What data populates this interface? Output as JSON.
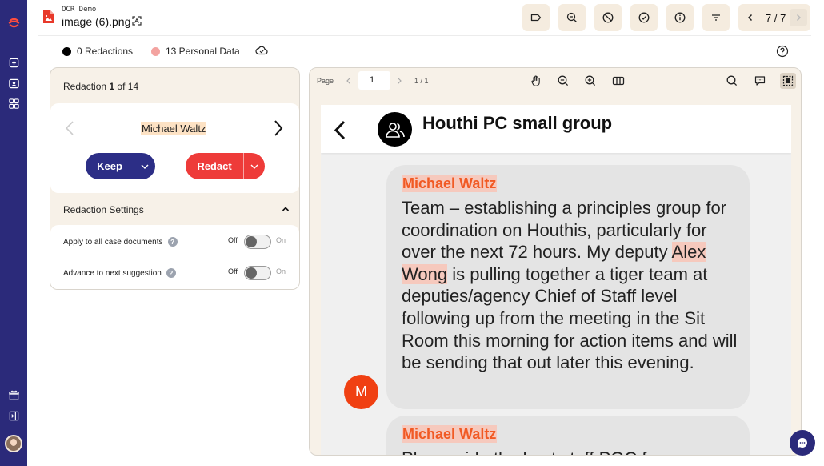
{
  "app": {
    "demo_label": "OCR Demo",
    "file_name": "image (6).png",
    "brand_color": "#2b2a7a",
    "accent_color": "#ee3b39"
  },
  "toolbar": {
    "icons": [
      "label-icon",
      "zoom-search-icon",
      "block-icon",
      "check-circle-icon",
      "info-icon",
      "filter-icon"
    ],
    "pager": {
      "count": "7 / 7"
    }
  },
  "stats": {
    "redactions": "0 Redactions",
    "personal_data": "13 Personal Data",
    "redaction_color": "#000000",
    "personal_data_color": "#f3a3a0"
  },
  "panel": {
    "title_prefix": "Redaction",
    "current": "1",
    "title_middle": " of ",
    "total": "14",
    "entity": "Michael Waltz",
    "keep_label": "Keep",
    "redact_label": "Redact",
    "settings_title": "Redaction Settings",
    "settings": [
      {
        "label": "Apply to all case documents",
        "off": "Off",
        "on": "On"
      },
      {
        "label": "Advance to next suggestion",
        "off": "Off",
        "on": "On"
      }
    ]
  },
  "viewer": {
    "page_label": "Page",
    "page_value": "1",
    "page_count": "1 / 1",
    "document": {
      "group_name": "Houthi PC small group",
      "messages": [
        {
          "sender": "Michael Waltz",
          "text_before": "Team – establishing a principles group for coordination on Houthis, particularly for over the next 72 hours. My deputy ",
          "highlight": "Alex Wong",
          "text_after": " is pulling together a tiger team at deputies/agency Chief of Staff level following up from the meeting in the Sit Room this morning for action items and will be sending that out later this evening.",
          "avatar_letter": "M"
        },
        {
          "sender": "Michael Waltz",
          "text_partial": "Pls provide the best staff POC for"
        }
      ]
    }
  }
}
